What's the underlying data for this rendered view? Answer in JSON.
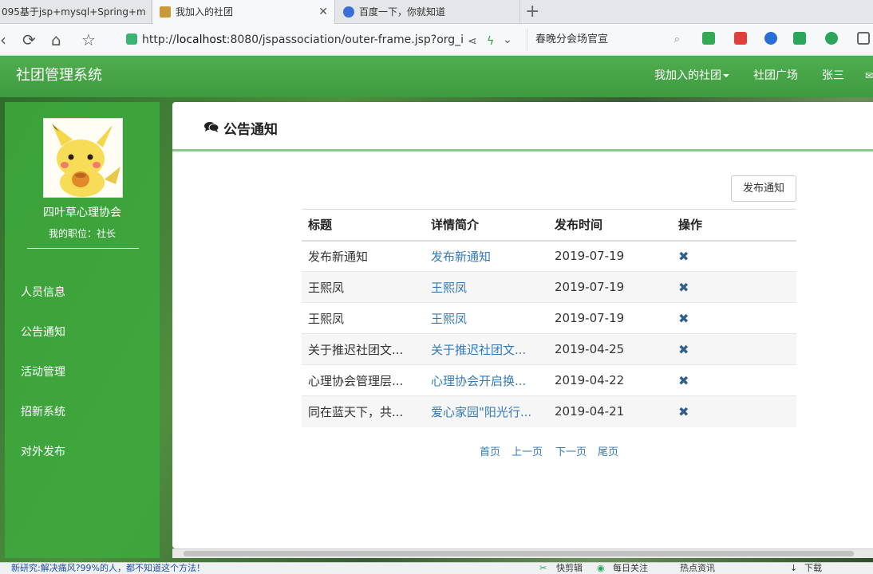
{
  "browser": {
    "tabs": [
      {
        "label": "095基于jsp+mysql+Spring+m",
        "active": false
      },
      {
        "label": "我加入的社团",
        "active": true
      },
      {
        "label": "百度一下，你就知道",
        "active": false
      }
    ],
    "url_prefix": "http://",
    "url_host": "localhost",
    "url_rest": ":8080/jspassociation/outer-frame.jsp?org_i",
    "search_text": "春晚分会场官宣"
  },
  "app": {
    "brand": "社团管理系统",
    "nav": {
      "my_clubs": "我加入的社团",
      "club_square": "社团广场",
      "user": "张三"
    }
  },
  "sidebar": {
    "club_name": "四叶草心理协会",
    "position": "我的职位：社长",
    "menu": [
      "人员信息",
      "公告通知",
      "活动管理",
      "招新系统",
      "对外发布"
    ]
  },
  "panel": {
    "title": "公告通知",
    "publish_button": "发布通知",
    "columns": [
      "标题",
      "详情简介",
      "发布时间",
      "操作"
    ],
    "rows": [
      {
        "title": "发布新通知",
        "summary": "发布新通知",
        "date": "2019-07-19"
      },
      {
        "title": "王熙凤",
        "summary": "王熙凤",
        "date": "2019-07-19"
      },
      {
        "title": "王熙凤",
        "summary": "王熙凤",
        "date": "2019-07-19"
      },
      {
        "title": "关于推迟社团文...",
        "summary": "关于推迟社团文...",
        "date": "2019-04-25"
      },
      {
        "title": "心理协会管理层...",
        "summary": "心理协会开启换...",
        "date": "2019-04-22"
      },
      {
        "title": "同在蓝天下，共...",
        "summary": "爱心家园\"阳光行...",
        "date": "2019-04-21"
      }
    ],
    "delete_glyph": "✖",
    "pager": {
      "first": "首页",
      "prev": "上一页",
      "next": "下一页",
      "last": "尾页"
    }
  },
  "statusbar": {
    "news": "新研究:解决痛风?99%的人，都不知道这个方法！",
    "tools": [
      "快剪辑",
      "每日关注",
      "热点资讯",
      "下载"
    ]
  }
}
